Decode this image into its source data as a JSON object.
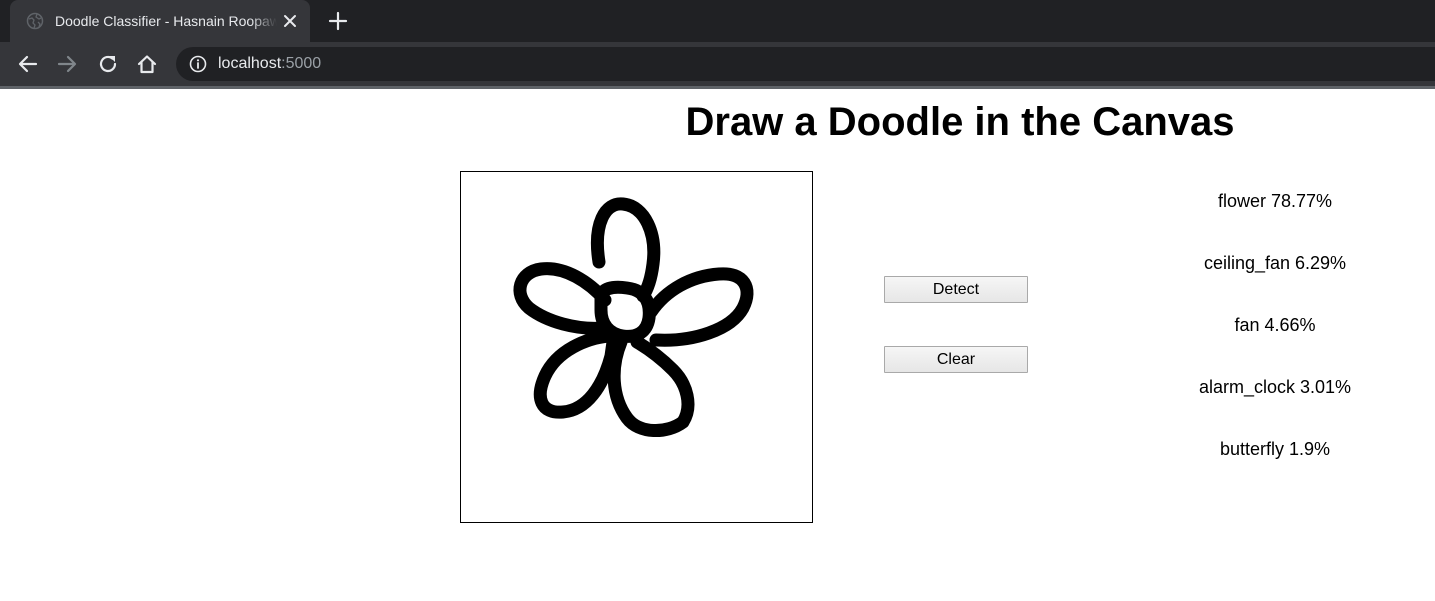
{
  "browser": {
    "tab_title": "Doodle Classifier - Hasnain Roopawalla",
    "url_host": "localhost",
    "url_port": ":5000",
    "icons": [
      "globe-icon",
      "close-icon",
      "plus-icon",
      "back-arrow-icon",
      "forward-arrow-icon",
      "reload-icon",
      "home-icon",
      "info-icon"
    ]
  },
  "page": {
    "title": "Draw a Doodle in the Canvas"
  },
  "controls": {
    "detect_label": "Detect",
    "clear_label": "Clear"
  },
  "predictions": [
    "flower 78.77%",
    "ceiling_fan 6.29%",
    "fan 4.66%",
    "alarm_clock 3.01%",
    "butterfly 1.9%"
  ],
  "colors": {
    "tabstrip": "#202124",
    "toolbar": "#35363a",
    "ink": "#000000"
  }
}
